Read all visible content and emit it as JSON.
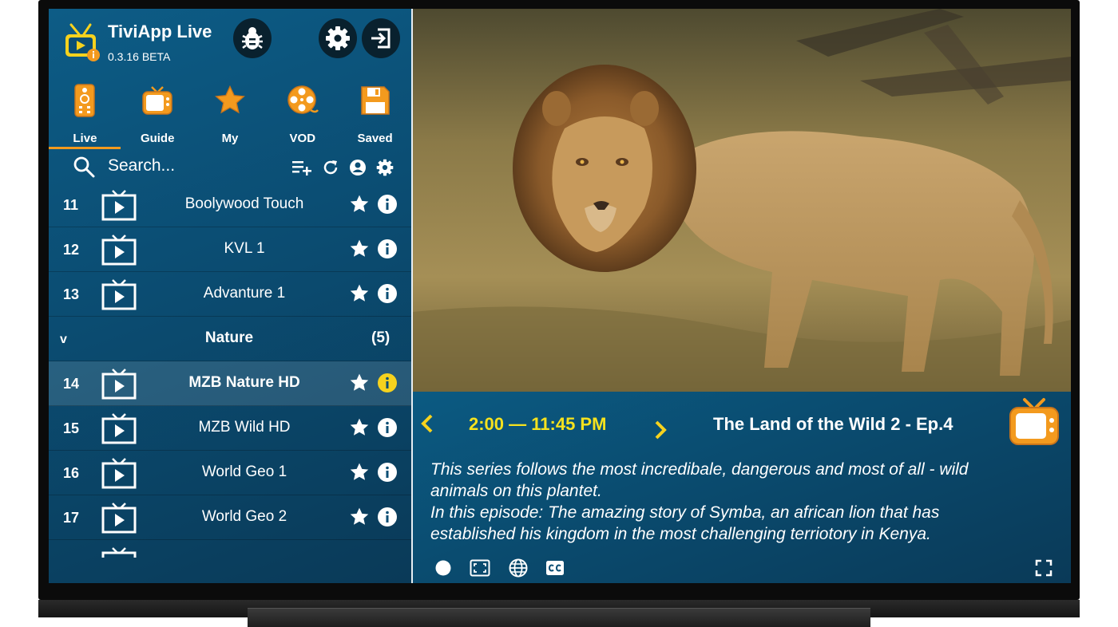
{
  "app": {
    "name": "TiviApp Live",
    "version": "0.3.16  BETA"
  },
  "header": {
    "bug_icon": "bug-icon",
    "settings_icon": "gear-icon",
    "exit_icon": "exit-icon"
  },
  "nav": {
    "tabs": [
      {
        "label": "Live",
        "icon": "remote-icon",
        "active": true
      },
      {
        "label": "Guide",
        "icon": "tv-guide-icon",
        "active": false
      },
      {
        "label": "My",
        "icon": "star-icon",
        "active": false
      },
      {
        "label": "VOD",
        "icon": "film-reel-icon",
        "active": false
      },
      {
        "label": "Saved",
        "icon": "floppy-icon",
        "active": false
      }
    ]
  },
  "search": {
    "placeholder": "Search..."
  },
  "channels": {
    "rows": [
      {
        "num": "11",
        "name": "Boolywood Touch"
      },
      {
        "num": "12",
        "name": "KVL 1"
      },
      {
        "num": "13",
        "name": "Advanture 1"
      }
    ],
    "group": {
      "name": "Nature",
      "count": "(5)",
      "chevron": "v"
    },
    "group_rows": [
      {
        "num": "14",
        "name": "MZB Nature HD",
        "selected": true
      },
      {
        "num": "15",
        "name": "MZB Wild HD"
      },
      {
        "num": "16",
        "name": "World Geo 1"
      },
      {
        "num": "17",
        "name": "World Geo 2"
      }
    ]
  },
  "epg": {
    "time": "2:00 — 11:45 PM",
    "title": "The Land of the Wild 2 - Ep.4",
    "description_lines": [
      "This series follows the most incredibale, dangerous and most of all - wild",
      "animals on this plantet.",
      "In this episode: The amazing story of Symba, an african lion that has",
      "established his kingdom in the most challenging terriotory in Kenya."
    ]
  },
  "colors": {
    "accent": "#f39a1e",
    "time_yellow": "#f6e21e",
    "panel_blue": "#0b4e74",
    "selected_info": "#f6d21e"
  }
}
